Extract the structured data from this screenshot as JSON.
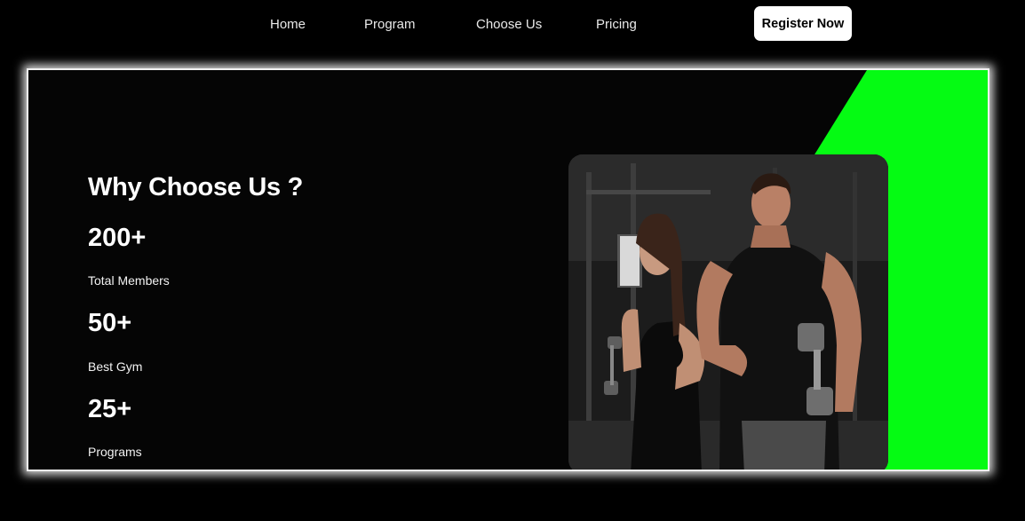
{
  "nav": {
    "links": [
      "Home",
      "Program",
      "Choose Us",
      "Pricing"
    ],
    "register_label": "Register Now"
  },
  "hero": {
    "heading": "Why Choose Us ?",
    "stats": [
      {
        "value": "200+",
        "label": "Total Members"
      },
      {
        "value": "50+",
        "label": "Best Gym"
      },
      {
        "value": "25+",
        "label": "Programs"
      }
    ],
    "accent_color": "#05fb13"
  }
}
